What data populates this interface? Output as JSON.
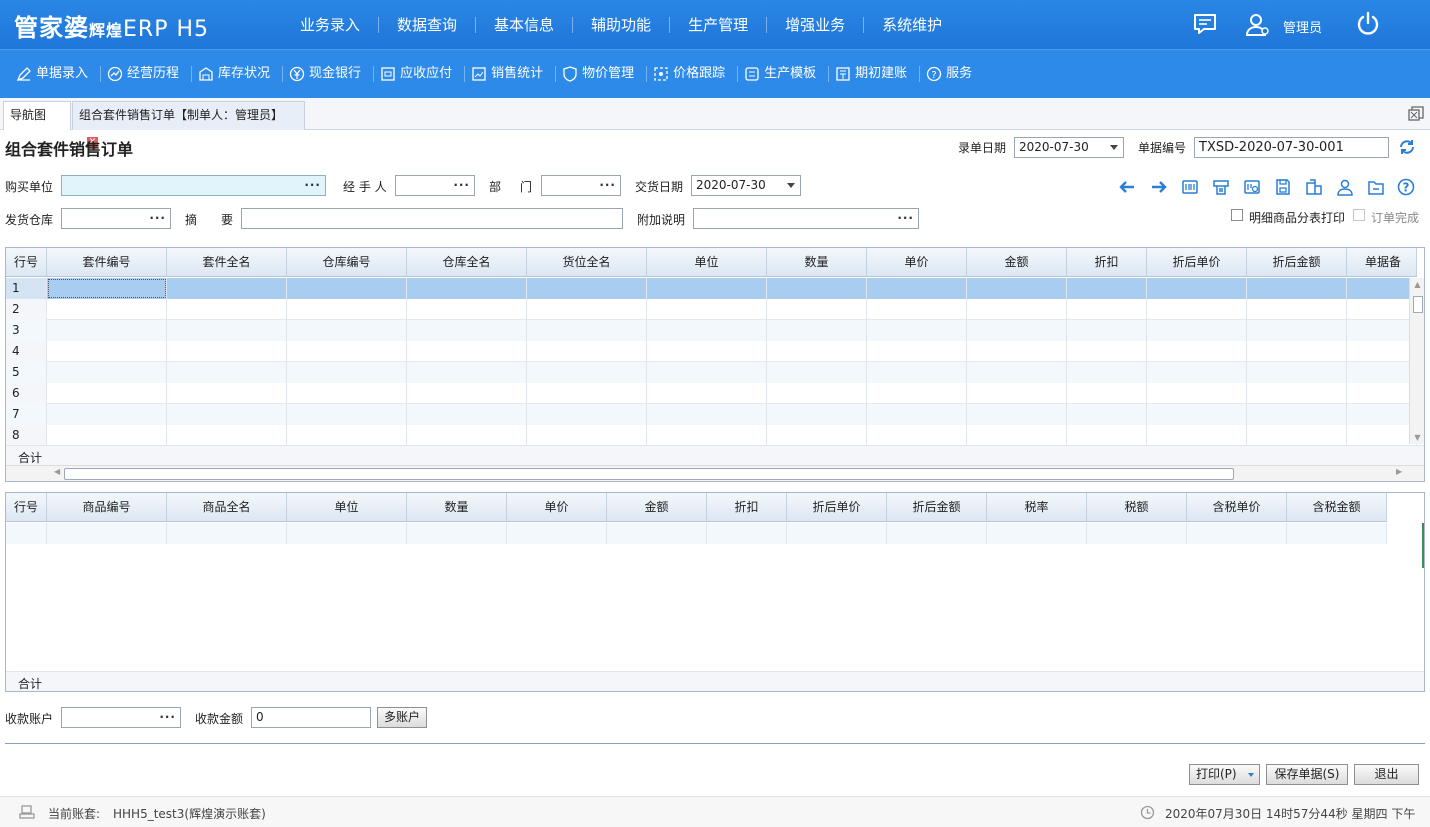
{
  "app": {
    "logo_main": "管家婆",
    "logo_sub": "辉煌",
    "logo_erp": "ERP H5",
    "user": "管理员"
  },
  "topnav": [
    "业务录入",
    "数据查询",
    "基本信息",
    "辅助功能",
    "生产管理",
    "增强业务",
    "系统维护"
  ],
  "subnav": [
    "单据录入",
    "经营历程",
    "库存状况",
    "现金银行",
    "应收应付",
    "销售统计",
    "物价管理",
    "价格跟踪",
    "生产模板",
    "期初建账",
    "服务"
  ],
  "tabs": {
    "nav": "导航图",
    "active": "组合套件销售订单【制单人：管理员】"
  },
  "form": {
    "title": "组合套件销售订单",
    "entry_date_label": "录单日期",
    "entry_date": "2020-07-30",
    "doc_no_label": "单据编号",
    "doc_no": "TXSD-2020-07-30-001",
    "buyer_label": "购买单位",
    "buyer": "",
    "handler_label": "经 手 人",
    "handler": "",
    "dept_label1": "部",
    "dept_label2": "门",
    "dept": "",
    "delivery_date_label": "交货日期",
    "delivery_date": "2020-07-30",
    "warehouse_label": "发货仓库",
    "warehouse": "",
    "summary_label1": "摘",
    "summary_label2": "要",
    "summary": "",
    "note_label": "附加说明",
    "note": "",
    "print_detail_label": "明细商品分表打印",
    "order_done_label": "订单完成",
    "dots": "···"
  },
  "grid1": {
    "columns": [
      "行号",
      "套件编号",
      "套件全名",
      "仓库编号",
      "仓库全名",
      "货位全名",
      "单位",
      "数量",
      "单价",
      "金额",
      "折扣",
      "折后单价",
      "折后金额",
      "单据备"
    ],
    "rows": [
      "1",
      "2",
      "3",
      "4",
      "5",
      "6",
      "7",
      "8"
    ],
    "total_label": "合计"
  },
  "grid2": {
    "columns": [
      "行号",
      "商品编号",
      "商品全名",
      "单位",
      "数量",
      "单价",
      "金额",
      "折扣",
      "折后单价",
      "折后金额",
      "税率",
      "税额",
      "含税单价",
      "含税金额"
    ],
    "total_label": "合计"
  },
  "payment": {
    "account_label": "收款账户",
    "account": "",
    "amount_label": "收款金额",
    "amount": "0",
    "multi_button": "多账户"
  },
  "buttons": {
    "print": "打印(P)",
    "save": "保存单据(S)",
    "exit": "退出"
  },
  "status": {
    "account_label": "当前账套:",
    "account_value": "HHH5_test3(辉煌演示账套)",
    "datetime": "2020年07月30日 14时57分44秒 星期四 下午"
  },
  "colors": {
    "header": "#1f76d8",
    "subnav": "#2e8ae8",
    "accent_icon": "#2a7fd4"
  }
}
